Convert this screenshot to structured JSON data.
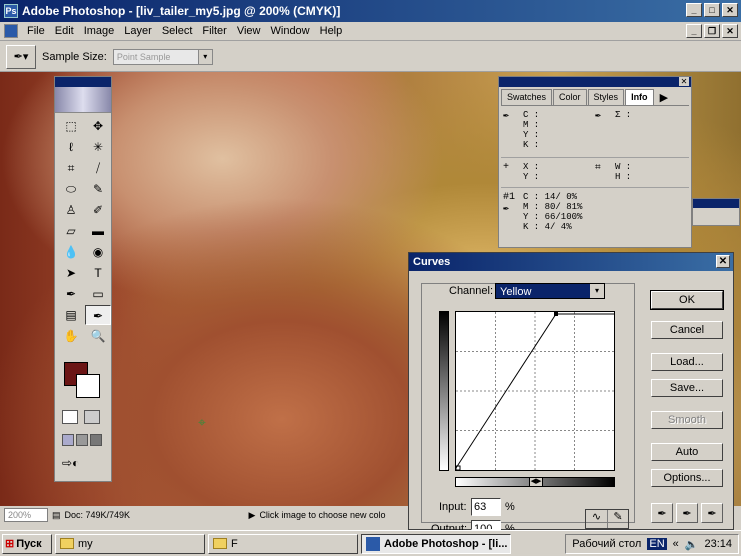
{
  "window": {
    "title": "Adobe Photoshop - [liv_tailer_my5.jpg @ 200% (CMYK)]"
  },
  "menu": [
    "File",
    "Edit",
    "Image",
    "Layer",
    "Select",
    "Filter",
    "View",
    "Window",
    "Help"
  ],
  "options": {
    "sample_size_label": "Sample Size:",
    "sample_size_value": "Point Sample"
  },
  "info_panel": {
    "tabs": [
      "Swatches",
      "Color",
      "Styles",
      "Info"
    ],
    "cmyk_labels": [
      "C :",
      "M :",
      "Y :",
      "K :"
    ],
    "opacity_label": "Σ :",
    "xy_labels": [
      "X :",
      "Y :"
    ],
    "wh_labels": [
      "W :",
      "H :"
    ],
    "sample_id": "#1",
    "sample_values": [
      "C :  14/ 0%",
      "M :  80/ 81%",
      "Y :  66/100%",
      "K :   4/  4%"
    ]
  },
  "curves": {
    "title": "Curves",
    "channel_label": "Channel:",
    "channel_value": "Yellow",
    "input_label": "Input:",
    "input_value": "63",
    "output_label": "Output:",
    "output_value": "100",
    "pct": "%",
    "buttons": {
      "ok": "OK",
      "cancel": "Cancel",
      "load": "Load...",
      "save": "Save...",
      "smooth": "Smooth",
      "auto": "Auto",
      "options": "Options..."
    }
  },
  "status": {
    "zoom": "200%",
    "doc": "Doc: 749K/749K",
    "hint": "Click image to choose new colo"
  },
  "taskbar": {
    "start": "Пуск",
    "tasks": [
      "my",
      "F",
      "Adobe Photoshop - [li..."
    ],
    "desktop": "Рабочий стол",
    "lang": "EN",
    "time": "23:14"
  },
  "colors": {
    "foreground": "#6b1515",
    "background": "#ffffff",
    "title_blue": "#0a246a"
  }
}
